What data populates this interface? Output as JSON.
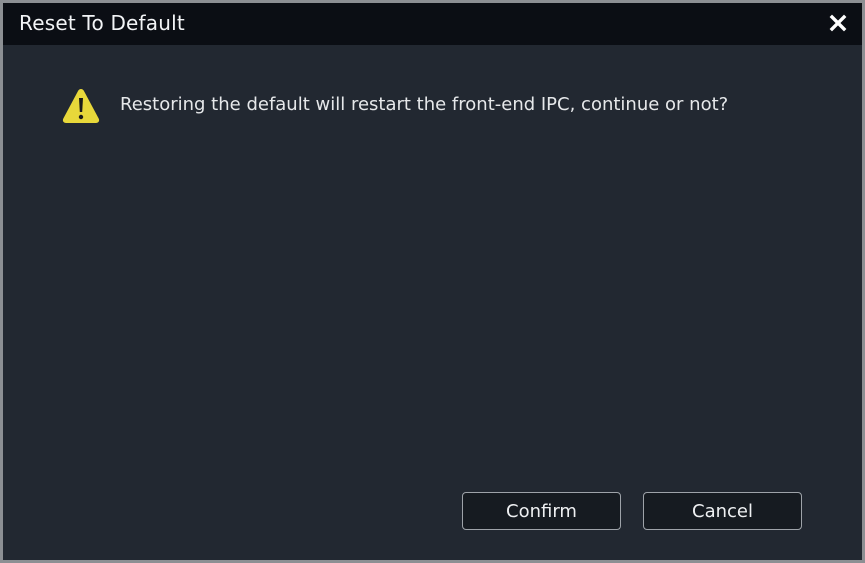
{
  "dialog": {
    "title": "Reset To Default",
    "close_icon": "close-icon",
    "warning_icon": "warning-triangle-icon",
    "message": "Restoring the default will restart the front-end IPC, continue or not?",
    "confirm_label": "Confirm",
    "cancel_label": "Cancel"
  },
  "colors": {
    "background": "#222831",
    "titlebar": "#0b0e14",
    "border": "#8c8f93",
    "warning": "#e8d83a",
    "text": "#e6e8ea"
  }
}
